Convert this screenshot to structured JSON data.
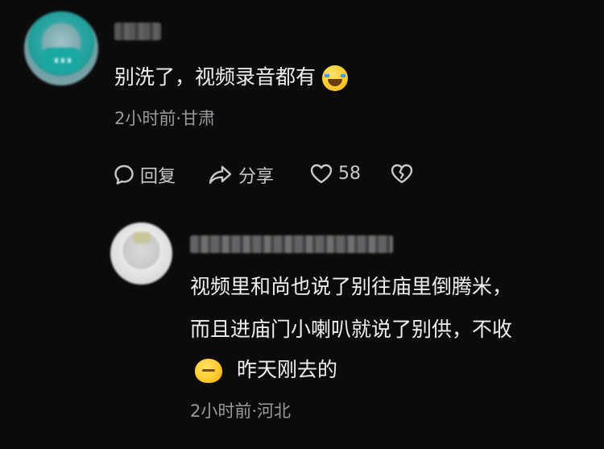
{
  "comment": {
    "text": "别洗了，视频录音都有",
    "emoji_icon": "rolling-on-floor-laughing-emoji",
    "meta": "2小时前·甘肃",
    "actions": {
      "reply_label": "回复",
      "share_label": "分享",
      "like_count": "58"
    }
  },
  "reply": {
    "line1": "视频里和尚也说了别往庙里倒腾米，",
    "line2": "而且进庙门小喇叭就说了别供，不收",
    "line3": "昨天刚去的",
    "emoji_icon": "sweat-emoji",
    "meta": "2小时前·河北"
  },
  "colors": {
    "background": "#0b0b0c",
    "text": "#f0f0f1",
    "meta": "#9a9a9e",
    "action": "#c9c9cc"
  }
}
